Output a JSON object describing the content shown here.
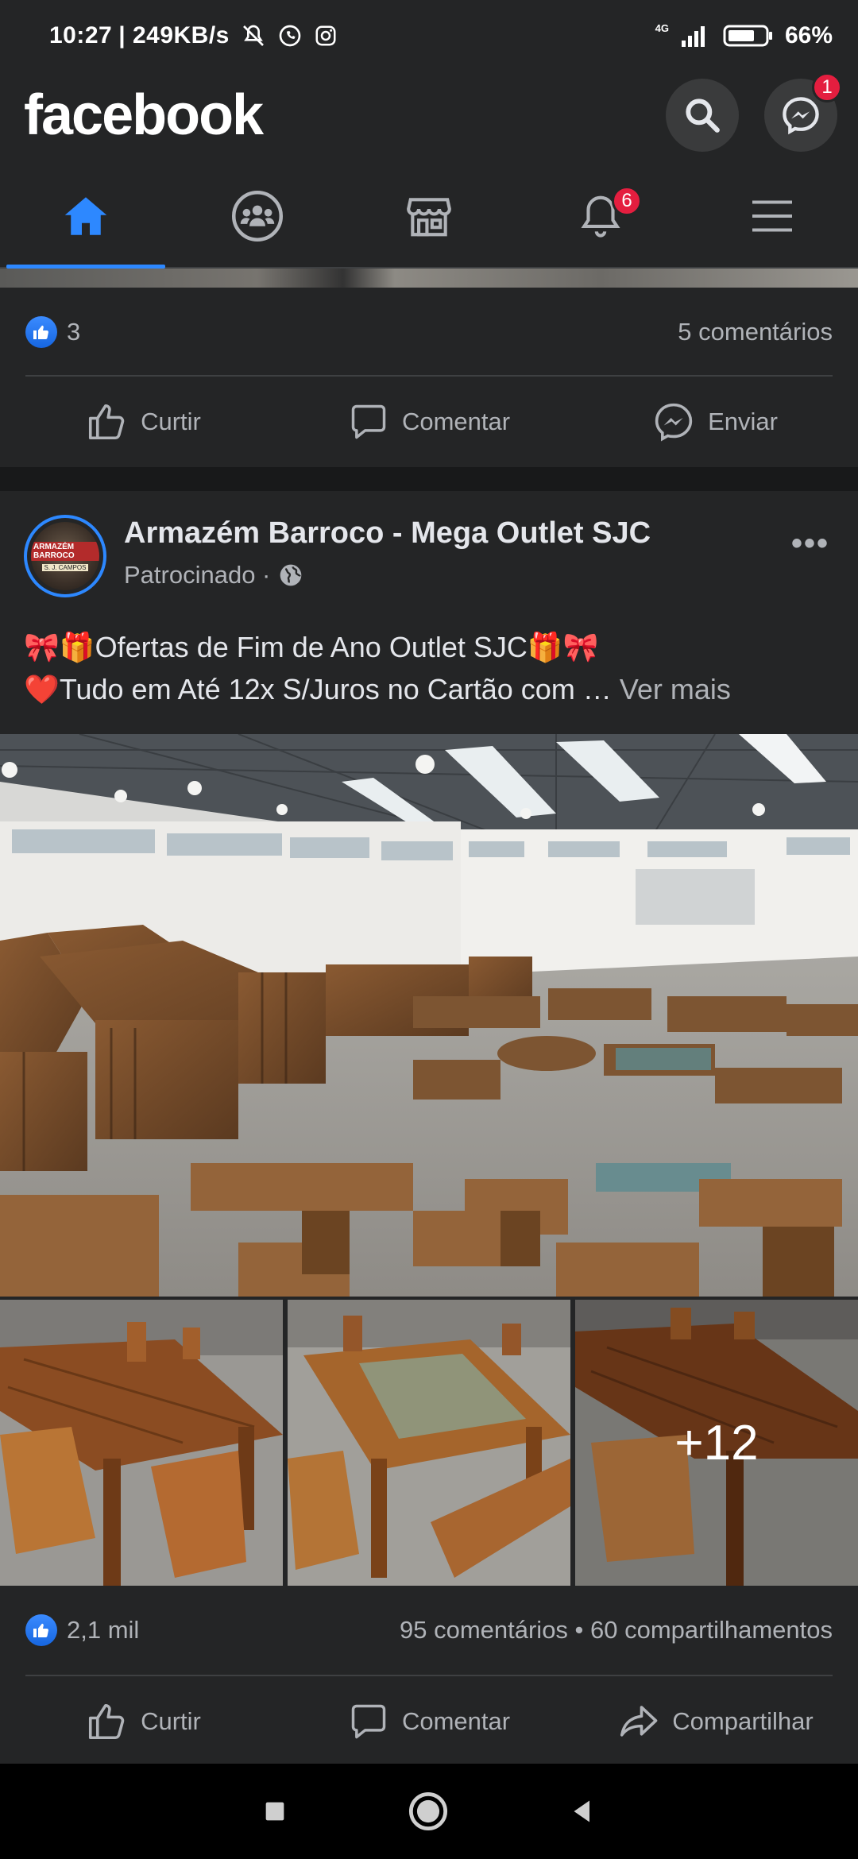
{
  "status_bar": {
    "time": "10:27",
    "net_speed": "| 249KB/s",
    "network": "4G",
    "battery": "66%"
  },
  "header": {
    "logo": "facebook",
    "messenger_badge": "1"
  },
  "nav": {
    "notifications_badge": "6"
  },
  "prev_post": {
    "likes": "3",
    "comments": "5 comentários",
    "actions": [
      "Curtir",
      "Comentar",
      "Enviar"
    ]
  },
  "post": {
    "page_name": "Armazém Barroco - Mega Outlet SJC",
    "sponsored": "Patrocinado ·",
    "avatar_text_top": "ARMAZÉM BARROCO",
    "avatar_text_bottom": "S. J. CAMPOS",
    "text_line1": "🎀🎁Ofertas de Fim de Ano Outlet SJC🎁🎀",
    "text_line2": "❤️Tudo em Até 12x S/Juros no Cartão com …",
    "see_more": "Ver mais",
    "more_photos": "+12",
    "likes": "2,1 mil",
    "stats": "95 comentários • 60 compartilhamentos",
    "actions": [
      "Curtir",
      "Comentar",
      "Compartilhar"
    ]
  },
  "colors": {
    "background": "#242526",
    "accent": "#2d88ff",
    "badge": "#e41e3f",
    "text_primary": "#e4e6eb",
    "text_secondary": "#b0b3b8"
  }
}
